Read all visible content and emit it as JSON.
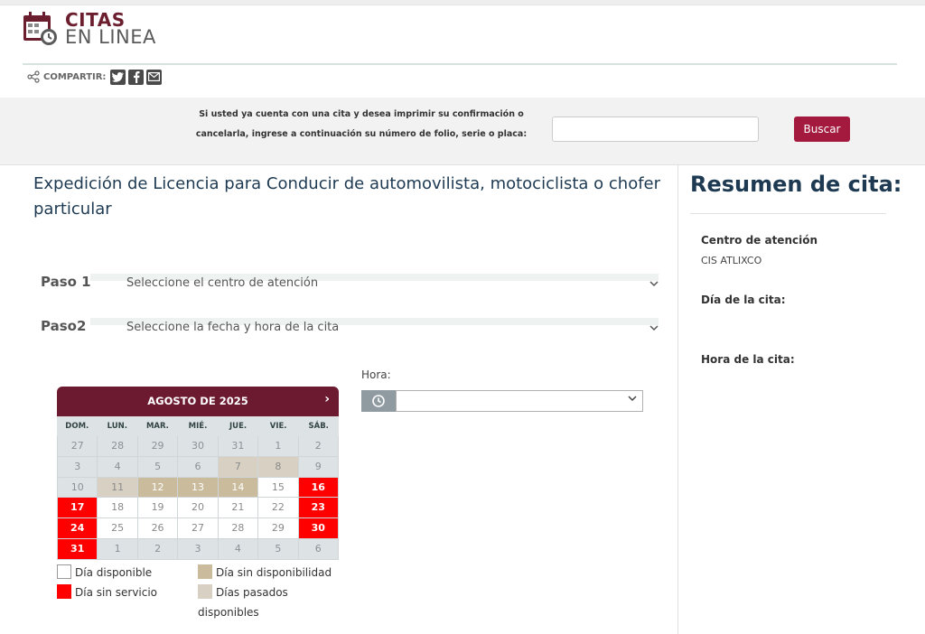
{
  "header": {
    "logo_line1": "CITAS",
    "logo_line2": "EN LINEA",
    "share_label": "COMPARTIR:",
    "social": [
      "twitter-icon",
      "facebook-icon",
      "mail-icon"
    ]
  },
  "search": {
    "text_line1": "Si usted ya cuenta con una cita y desea imprimir su confirmación o",
    "text_line2": "cancelarla, ingrese a continuación su número de folio, serie o placa:",
    "input_value": "",
    "button_label": "Buscar"
  },
  "main": {
    "title": "Expedición de Licencia para Conducir de automovilista, motociclista o chofer particular",
    "steps": [
      {
        "num": "Paso 1",
        "text": "Seleccione el centro de atención"
      },
      {
        "num": "Paso2",
        "text": "Seleccione la fecha y hora de la cita"
      }
    ]
  },
  "calendar": {
    "month": "AGOSTO DE 2025",
    "next": "›",
    "dows": [
      "DOM.",
      "LUN.",
      "MAR.",
      "MIÉ.",
      "JUE.",
      "VIE.",
      "SÁB."
    ],
    "days": [
      {
        "d": "27",
        "s": "past"
      },
      {
        "d": "28",
        "s": "past"
      },
      {
        "d": "29",
        "s": "past"
      },
      {
        "d": "30",
        "s": "past"
      },
      {
        "d": "31",
        "s": "past"
      },
      {
        "d": "1",
        "s": "past"
      },
      {
        "d": "2",
        "s": "past"
      },
      {
        "d": "3",
        "s": "past"
      },
      {
        "d": "4",
        "s": "past"
      },
      {
        "d": "5",
        "s": "past"
      },
      {
        "d": "6",
        "s": "past"
      },
      {
        "d": "7",
        "s": "pastdisp"
      },
      {
        "d": "8",
        "s": "pastdisp"
      },
      {
        "d": "9",
        "s": "past"
      },
      {
        "d": "10",
        "s": "past"
      },
      {
        "d": "11",
        "s": "pastdisp"
      },
      {
        "d": "12",
        "s": "nodisp"
      },
      {
        "d": "13",
        "s": "nodisp"
      },
      {
        "d": "14",
        "s": "nodisp"
      },
      {
        "d": "15",
        "s": "avail"
      },
      {
        "d": "16",
        "s": "nosvc"
      },
      {
        "d": "17",
        "s": "nosvc"
      },
      {
        "d": "18",
        "s": "avail"
      },
      {
        "d": "19",
        "s": "avail"
      },
      {
        "d": "20",
        "s": "avail"
      },
      {
        "d": "21",
        "s": "avail"
      },
      {
        "d": "22",
        "s": "avail"
      },
      {
        "d": "23",
        "s": "nosvc"
      },
      {
        "d": "24",
        "s": "nosvc"
      },
      {
        "d": "25",
        "s": "avail"
      },
      {
        "d": "26",
        "s": "avail"
      },
      {
        "d": "27",
        "s": "avail"
      },
      {
        "d": "28",
        "s": "avail"
      },
      {
        "d": "29",
        "s": "avail"
      },
      {
        "d": "30",
        "s": "nosvc"
      },
      {
        "d": "31",
        "s": "nosvc"
      },
      {
        "d": "1",
        "s": "past"
      },
      {
        "d": "2",
        "s": "past"
      },
      {
        "d": "3",
        "s": "past"
      },
      {
        "d": "4",
        "s": "past"
      },
      {
        "d": "5",
        "s": "past"
      },
      {
        "d": "6",
        "s": "past"
      }
    ],
    "legend": {
      "available": "Día disponible",
      "no_service": "Día sin servicio",
      "no_availability": "Día sin disponibilidad",
      "past_available_1": "Días pasados",
      "past_available_2": "disponibles"
    },
    "colors": {
      "header": "#6b1a30",
      "no_service": "#ff0000",
      "no_availability": "#c9bb9c",
      "past_available": "#d8d1c3",
      "past": "#dde3e5"
    }
  },
  "hora": {
    "label": "Hora:",
    "selected": ""
  },
  "summary": {
    "title": "Resumen de cita:",
    "center_label": "Centro de atención",
    "center_value": "CIS ATLIXCO",
    "date_label": "Día de la cita:",
    "time_label": "Hora de la cita:"
  }
}
